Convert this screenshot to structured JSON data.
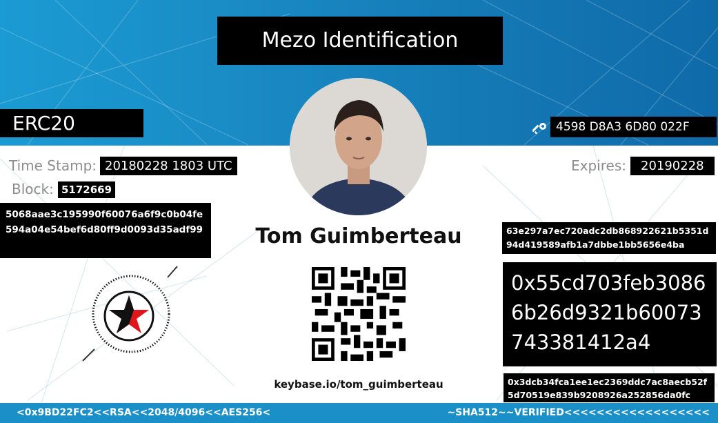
{
  "card": {
    "title": "Mezo Identification",
    "token_type": "ERC20",
    "key_fingerprint": "4598 D8A3 6D80 022F",
    "timestamp_label": "Time Stamp:",
    "timestamp_value": "20180228 1803 UTC",
    "block_label": "Block:",
    "block_value": "5172669",
    "expires_label": "Expires:",
    "expires_value": "20190228",
    "hash_left": "5068aae3c195990f60076a6f9c0b04fe594a04e54bef6d80ff9d0093d35adf99",
    "hash_right_top": "63e297a7ec720adc2db868922621b5351d94d419589afb1a7dbbe1bb5656e4ba",
    "address": "0x55cd703feb30866b26d9321b60073743381412a4",
    "hash_right_bottom": "0x3dcb34fca1ee1ec2369ddc7ac8aecb52f5d70519e839b9208926a252856da0fc",
    "name": "Tom Guimberteau",
    "keybase": "keybase.io/tom_guimberteau"
  },
  "footer": {
    "left": "<0x9BD22FC2<<RSA<<2048/4096<<AES256<",
    "right": "~SHA512~~VERIFIED<<<<<<<<<<<<<<<<<<"
  },
  "icons": {
    "key": "key-icon",
    "star": "red-black-star-icon",
    "qr": "qr-code"
  },
  "colors": {
    "band": "#1b8fc8",
    "star_red": "#e0161c"
  }
}
